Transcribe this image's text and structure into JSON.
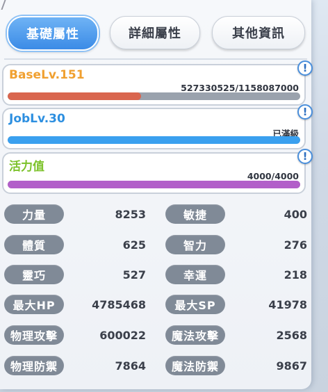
{
  "tabs": [
    {
      "label": "基礎屬性"
    },
    {
      "label": "詳細屬性"
    },
    {
      "label": "其他資訊"
    }
  ],
  "levels": [
    {
      "title": "BaseLv.151",
      "value": "527330525/1158087000",
      "progress": 0.455,
      "color": "#f0a030",
      "fill": "#d9664f"
    },
    {
      "title": "JobLv.30",
      "value": "已滿級",
      "progress": 1.0,
      "color": "#2d8fe0",
      "fill": "#3aa0ef"
    },
    {
      "title": "活力值",
      "value": "4000/4000",
      "progress": 1.0,
      "color": "#7cc22a",
      "fill": "#b25fc9"
    }
  ],
  "info_icon": "!",
  "stats": [
    {
      "label": "力量",
      "value": "8253"
    },
    {
      "label": "敏捷",
      "value": "400"
    },
    {
      "label": "體質",
      "value": "625"
    },
    {
      "label": "智力",
      "value": "276"
    },
    {
      "label": "靈巧",
      "value": "527"
    },
    {
      "label": "幸運",
      "value": "218"
    },
    {
      "label": "最大HP",
      "value": "4785468"
    },
    {
      "label": "最大SP",
      "value": "41978"
    },
    {
      "label": "物理攻擊",
      "value": "600022"
    },
    {
      "label": "魔法攻擊",
      "value": "2568"
    },
    {
      "label": "物理防禦",
      "value": "7864"
    },
    {
      "label": "魔法防禦",
      "value": "9867"
    }
  ]
}
